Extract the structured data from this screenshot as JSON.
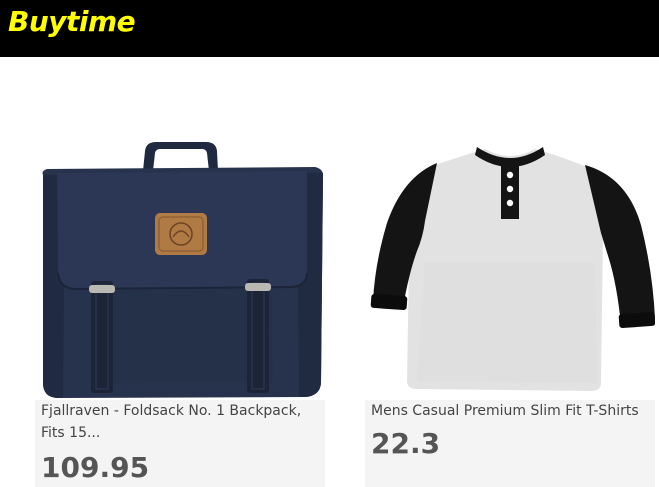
{
  "header": {
    "brand": "Buytime",
    "brand_color": "#ffff00",
    "background": "#000000"
  },
  "products": [
    {
      "title": "Fjallraven - Foldsack No. 1 Backpack, Fits 15...",
      "price": "109.95",
      "image": "navy-backpack"
    },
    {
      "title": "Mens Casual Premium Slim Fit T-Shirts",
      "price": "22.3",
      "image": "raglan-henley-shirt"
    }
  ]
}
